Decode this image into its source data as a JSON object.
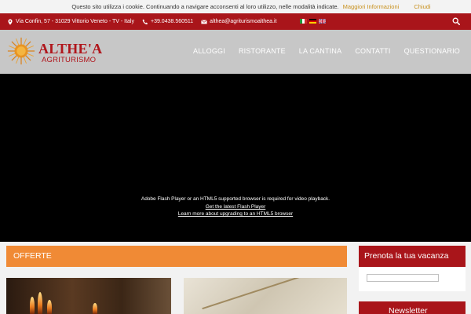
{
  "cookie": {
    "text": "Questo sito utilizza i cookie. Continuando a navigare acconsenti al loro utilizzo, nelle modalità indicate.",
    "more_label": "Maggiori Informazioni",
    "close_label": "Chiudi"
  },
  "topbar": {
    "address": "Via Confin, 57 - 31029 Vittorio Veneto - TV - Italy",
    "phone": "+39.0438.560511",
    "email": "althea@agriturismoalthea.it",
    "languages": [
      "it",
      "de",
      "en"
    ]
  },
  "logo": {
    "brand": "ALTHE'A",
    "sub": "AGRITURISMO"
  },
  "nav": {
    "items": [
      "ALLOGGI",
      "RISTORANTE",
      "LA CANTINA",
      "CONTATTI",
      "QUESTIONARIO"
    ]
  },
  "video": {
    "message": "Adobe Flash Player or an HTML5 supported browser is required for video playback.",
    "link_flash": "Get the latest Flash Player",
    "link_html5": "Learn more about upgrading to an HTML5 browser"
  },
  "main": {
    "offers_title": "OFFERTE"
  },
  "sidebar": {
    "booking_title": "Prenota la tua vacanza",
    "newsletter_title": "Newsletter"
  },
  "colors": {
    "brand_red": "#a9151a",
    "offers_orange": "#f08a35",
    "header_grey": "#c7c7c7",
    "cookie_link": "#c8911e"
  }
}
